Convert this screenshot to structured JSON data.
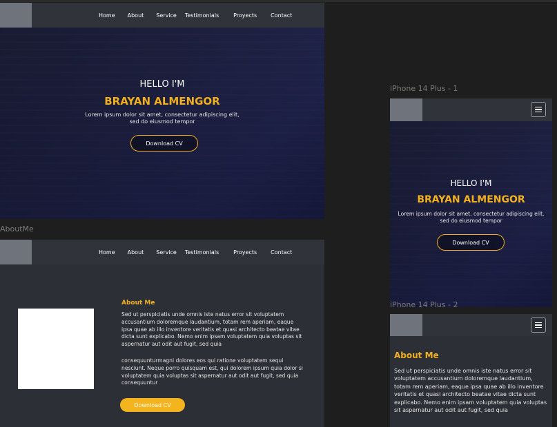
{
  "nav": {
    "items": [
      "Home",
      "About",
      "Service",
      "Testimonials",
      "Proyects",
      "Contact"
    ]
  },
  "hero": {
    "greeting": "HELLO I'M",
    "name": "BRAYAN ALMENGOR",
    "tagline_1": "Lorem ipsum dolor sit amet, consectetur adipiscing elit,",
    "tagline_2": "sed do eiusmod tempor",
    "cta": "Download CV"
  },
  "labels": {
    "about_artboard": "AboutMe",
    "iphone1": "iPhone 14 Plus - 1",
    "iphone2": "iPhone 14 Plus - 2"
  },
  "about": {
    "title": "About Me",
    "para1": "Sed ut perspiciatis unde omnis iste natus error sit voluptatem accusantium doloremque laudantium, totam rem aperiam, eaque ipsa quae ab illo inventore veritatis et quasi architecto beatae vitae dicta sunt explicabo. Nemo enim ipsam voluptatem quia voluptas sit aspernatur aut odit aut fugit, sed quia",
    "para2": "consequunturmagni dolores eos qui ratione voluptatem sequi nesciunt. Neque porro quisquam est, qui dolorem ipsum quia dolor si voluptatem quia voluptas sit aspernatur aut odit aut fugit, sed quia consequuntur",
    "cta": "Download CV"
  },
  "colors": {
    "accent": "#f2b01e",
    "nav_bg": "#30333a",
    "canvas_bg": "#1e1e1e"
  }
}
